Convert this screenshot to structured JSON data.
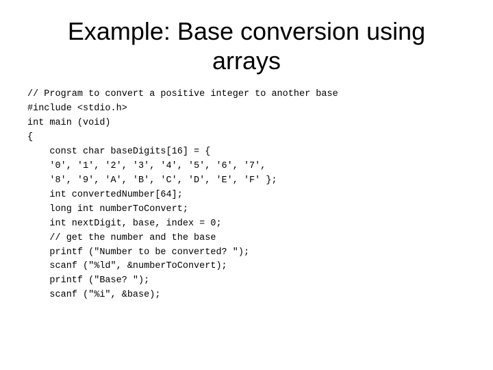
{
  "slide": {
    "title_line1": "Example: Base conversion using",
    "title_line2": "arrays",
    "code": "// Program to convert a positive integer to another base\n#include <stdio.h>\nint main (void)\n{\n    const char baseDigits[16] = {\n    '0', '1', '2', '3', '4', '5', '6', '7',\n    '8', '9', 'A', 'B', 'C', 'D', 'E', 'F' };\n    int convertedNumber[64];\n    long int numberToConvert;\n    int nextDigit, base, index = 0;\n    // get the number and the base\n    printf (\"Number to be converted? \");\n    scanf (\"%ld\", &numberToConvert);\n    printf (\"Base? \");\n    scanf (\"%i\", &base);"
  }
}
